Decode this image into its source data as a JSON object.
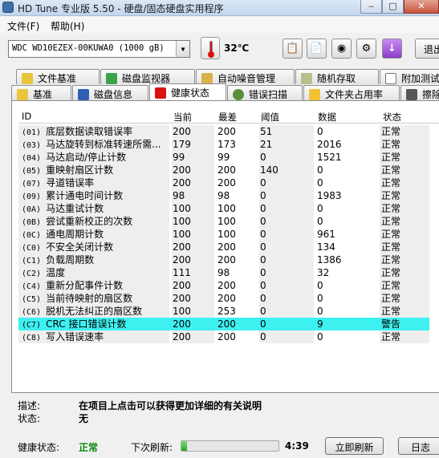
{
  "window": {
    "title": "HD Tune 专业版 5.50 - 硬盘/固态硬盘实用程序"
  },
  "menu": {
    "file": "文件(F)",
    "help": "帮助(H)"
  },
  "toolbar": {
    "drive": "WDC WD10EZEX-00KUWA0 (1000 gB)",
    "temperature": "32℃",
    "exit_label": "退出"
  },
  "tabs_row1": [
    "文件基准",
    "磁盘监视器",
    "自动噪音管理",
    "随机存取",
    "附加测试"
  ],
  "tabs_row2": [
    "基准",
    "磁盘信息",
    "健康状态",
    "错误扫描",
    "文件夹占用率",
    "擦除"
  ],
  "grid": {
    "headers": {
      "id": "ID",
      "current": "当前",
      "worst": "最差",
      "threshold": "阈值",
      "data": "数据",
      "status": "状态"
    },
    "rows": [
      {
        "id": "(01)",
        "name": "底层数据读取错误率",
        "current": "200",
        "worst": "200",
        "threshold": "51",
        "data": "0",
        "status": "正常"
      },
      {
        "id": "(03)",
        "name": "马达旋转到标准转速所需...",
        "current": "179",
        "worst": "173",
        "threshold": "21",
        "data": "2016",
        "status": "正常"
      },
      {
        "id": "(04)",
        "name": "马达启动/停止计数",
        "current": "99",
        "worst": "99",
        "threshold": "0",
        "data": "1521",
        "status": "正常"
      },
      {
        "id": "(05)",
        "name": "重映射扇区计数",
        "current": "200",
        "worst": "200",
        "threshold": "140",
        "data": "0",
        "status": "正常"
      },
      {
        "id": "(07)",
        "name": "寻道错误率",
        "current": "200",
        "worst": "200",
        "threshold": "0",
        "data": "0",
        "status": "正常"
      },
      {
        "id": "(09)",
        "name": "累计通电时间计数",
        "current": "98",
        "worst": "98",
        "threshold": "0",
        "data": "1983",
        "status": "正常"
      },
      {
        "id": "(0A)",
        "name": "马达重试计数",
        "current": "100",
        "worst": "100",
        "threshold": "0",
        "data": "0",
        "status": "正常"
      },
      {
        "id": "(0B)",
        "name": "尝试重新校正的次数",
        "current": "100",
        "worst": "100",
        "threshold": "0",
        "data": "0",
        "status": "正常"
      },
      {
        "id": "(0C)",
        "name": "通电周期计数",
        "current": "100",
        "worst": "100",
        "threshold": "0",
        "data": "961",
        "status": "正常"
      },
      {
        "id": "(C0)",
        "name": "不安全关闭计数",
        "current": "200",
        "worst": "200",
        "threshold": "0",
        "data": "134",
        "status": "正常"
      },
      {
        "id": "(C1)",
        "name": "负载周期数",
        "current": "200",
        "worst": "200",
        "threshold": "0",
        "data": "1386",
        "status": "正常"
      },
      {
        "id": "(C2)",
        "name": "温度",
        "current": "111",
        "worst": "98",
        "threshold": "0",
        "data": "32",
        "status": "正常"
      },
      {
        "id": "(C4)",
        "name": "重新分配事件计数",
        "current": "200",
        "worst": "200",
        "threshold": "0",
        "data": "0",
        "status": "正常"
      },
      {
        "id": "(C5)",
        "name": "当前待映射的扇区数",
        "current": "200",
        "worst": "200",
        "threshold": "0",
        "data": "0",
        "status": "正常"
      },
      {
        "id": "(C6)",
        "name": "脱机无法纠正的扇区数",
        "current": "100",
        "worst": "253",
        "threshold": "0",
        "data": "0",
        "status": "正常"
      },
      {
        "id": "(C7)",
        "name": "CRC 接口错误计数",
        "current": "200",
        "worst": "200",
        "threshold": "0",
        "data": "9",
        "status": "警告"
      },
      {
        "id": "(C8)",
        "name": "写入错误速率",
        "current": "200",
        "worst": "200",
        "threshold": "0",
        "data": "0",
        "status": "正常"
      }
    ]
  },
  "description": {
    "desc_label": "描述:",
    "desc_value": "在项目上点击可以获得更加详细的有关说明",
    "status_label": "状态:",
    "status_value": "无"
  },
  "statusbar": {
    "health_label": "健康状态:",
    "health_value": "正常",
    "refresh_label": "下次刷新:",
    "refresh_progress": 0.06,
    "countdown": "4:39",
    "refresh_button": "立即刷新",
    "log_button": "日志"
  },
  "colors": {
    "highlight": "#3ff0f0",
    "health_ok": "#0a8a0a"
  }
}
